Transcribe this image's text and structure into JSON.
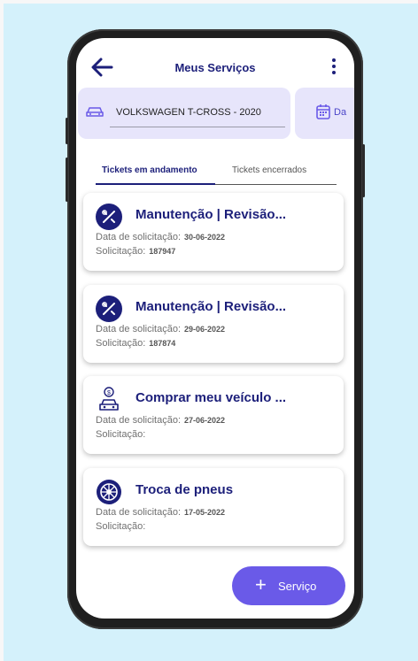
{
  "header": {
    "title": "Meus Serviços",
    "back_icon": "arrow-left-icon",
    "menu_icon": "more-vertical-icon"
  },
  "vehicle_chip": {
    "icon": "car-icon",
    "label": "VOLKSWAGEN T-CROSS - 2020"
  },
  "date_chip": {
    "icon": "calendar-icon",
    "label": "Da"
  },
  "tabs": [
    {
      "label": "Tickets em andamento",
      "active": true
    },
    {
      "label": "Tickets encerrados",
      "active": false
    }
  ],
  "tickets": [
    {
      "icon": "tools-icon",
      "title": "Manutenção | Revisão...",
      "date_label": "Data de solicitação:",
      "date": "30-06-2022",
      "request_label": "Solicitação:",
      "request": "187947"
    },
    {
      "icon": "tools-icon",
      "title": "Manutenção | Revisão...",
      "date_label": "Data de solicitação:",
      "date": "29-06-2022",
      "request_label": "Solicitação:",
      "request": "187874"
    },
    {
      "icon": "car-money-icon",
      "title": "Comprar meu veículo ...",
      "date_label": "Data de solicitação:",
      "date": "27-06-2022",
      "request_label": "Solicitação:",
      "request": ""
    },
    {
      "icon": "tire-icon",
      "title": "Troca de pneus",
      "date_label": "Data de solicitação:",
      "date": "17-05-2022",
      "request_label": "Solicitação:",
      "request": ""
    }
  ],
  "fab": {
    "plus": "+",
    "label": "Serviço"
  },
  "colors": {
    "primary": "#1c1f7a",
    "accent": "#6a5ae8",
    "chip_bg": "#e7e5fb",
    "background": "#d4f1fb"
  }
}
